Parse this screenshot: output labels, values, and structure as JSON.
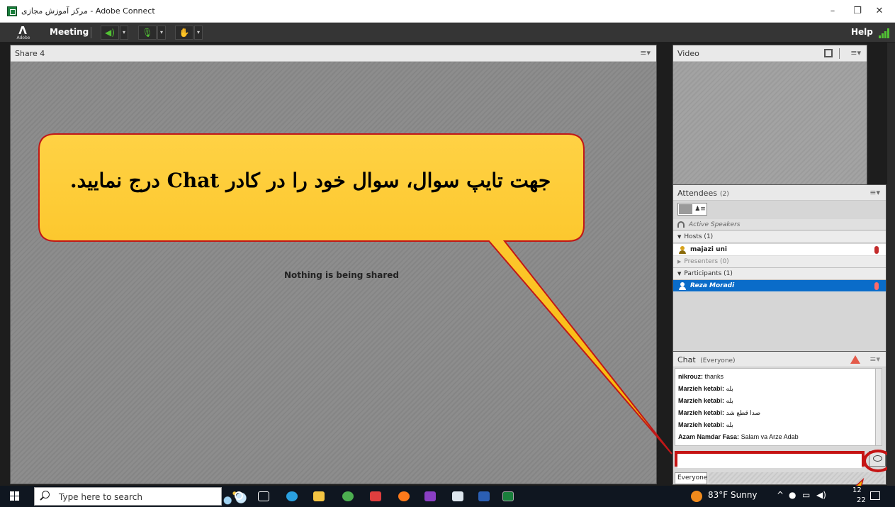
{
  "window": {
    "title": "مرکز آموزش مجازی - Adobe Connect",
    "minimize": "–",
    "restore": "❐",
    "close": "✕"
  },
  "toolbar": {
    "logo": "Λ",
    "logo_sub": "Adobe",
    "meeting_menu": "Meeting",
    "help": "Help"
  },
  "share_pod": {
    "title": "Share 4",
    "menu_glyph": "≡▾",
    "status": "Nothing is being shared"
  },
  "video_pod": {
    "title": "Video",
    "menu_glyph": "≡▾"
  },
  "attendees_pod": {
    "title": "Attendees",
    "count": "(2)",
    "menu_glyph": "≡▾",
    "active_speakers": "Active Speakers",
    "groups": [
      {
        "label": "Hosts (1)",
        "expanded": true
      },
      {
        "label": "Presenters (0)",
        "expanded": false
      },
      {
        "label": "Participants (1)",
        "expanded": true
      }
    ],
    "hosts": [
      {
        "name": "majazi uni"
      }
    ],
    "participants": [
      {
        "name": "Reza Moradi",
        "selected": true
      }
    ]
  },
  "chat_pod": {
    "title": "Chat",
    "scope": "(Everyone)",
    "menu_glyph": "≡▾",
    "messages": [
      {
        "sender": "nikrouz:",
        "text": "thanks"
      },
      {
        "sender": "Marzieh ketabi:",
        "text": "بله"
      },
      {
        "sender": "Marzieh ketabi:",
        "text": "بله"
      },
      {
        "sender": "Marzieh ketabi:",
        "text": "صدا قطع شد"
      },
      {
        "sender": "Marzieh ketabi:",
        "text": "بله"
      },
      {
        "sender": "Azam Namdar Fasa:",
        "text": "Salam va Arze Adab"
      }
    ],
    "input_value": "",
    "recipient_tab": "Everyone"
  },
  "callout": {
    "text": "جهت تایپ سوال، سوال خود را در کادر Chat درج نمایید."
  },
  "taskbar": {
    "search_placeholder": "Type here to search",
    "weather": "83°F  Sunny",
    "clock_partial": "12",
    "date_partial": "22"
  },
  "colors": {
    "callout_fill": "#fdc62e",
    "callout_border": "#c01818",
    "highlight_red": "#c51414",
    "selected_row": "#0a6cc9",
    "toolbar_bg": "#353535"
  }
}
